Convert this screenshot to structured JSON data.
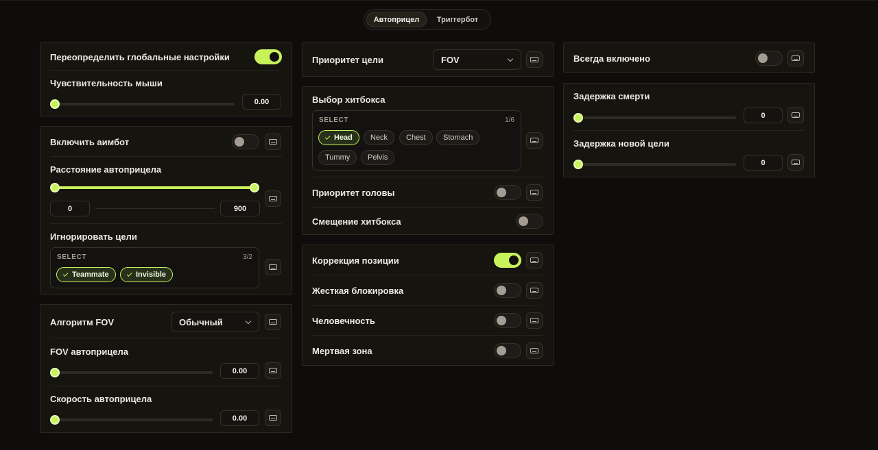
{
  "tabs": [
    "Автоприцел",
    "Триггербот"
  ],
  "colors": {
    "accent": "#c8f25a",
    "bg": "#0e0d0b",
    "panel": "#16140f"
  },
  "col1": {
    "override_label": "Переопределить глобальные настройки",
    "override_on": true,
    "sensitivity_label": "Чувствительность мыши",
    "sensitivity_value": "0.00",
    "enable_aimbot_label": "Включить аимбот",
    "enable_aimbot_on": false,
    "distance_label": "Расстояние автоприцела",
    "distance_min": "0",
    "distance_max": "900",
    "ignore_label": "Игнорировать цели",
    "ignore_select_header": "SELECT",
    "ignore_count": "3/2",
    "ignore_chips": [
      "Teammate",
      "Invisible"
    ],
    "fov_algo_label": "Алгоритм FOV",
    "fov_algo_value": "Обычный",
    "fov_label": "FOV автоприцела",
    "fov_value": "0.00",
    "speed_label": "Скорость автоприцела",
    "speed_value": "0.00"
  },
  "col2": {
    "priority_label": "Приоритет цели",
    "priority_value": "FOV",
    "hitbox_label": "Выбор хитбокса",
    "hitbox_select_header": "SELECT",
    "hitbox_count": "1/6",
    "hitbox_chips": [
      "Head",
      "Neck",
      "Chest",
      "Stomach",
      "Tummy",
      "Pelvis"
    ],
    "hitbox_selected": [
      "Head"
    ],
    "head_priority_label": "Приоритет головы",
    "head_priority_on": false,
    "hitbox_offset_label": "Смещение хитбокса",
    "hitbox_offset_on": false,
    "pos_correction_label": "Коррекция позиции",
    "pos_correction_on": true,
    "hard_lock_label": "Жесткая блокировка",
    "hard_lock_on": false,
    "humanity_label": "Человечность",
    "humanity_on": false,
    "deadzone_label": "Мертвая зона",
    "deadzone_on": false
  },
  "col3": {
    "always_on_label": "Всегда включено",
    "always_on": false,
    "death_delay_label": "Задержка смерти",
    "death_delay_value": "0",
    "new_target_delay_label": "Задержка новой цели",
    "new_target_delay_value": "0"
  }
}
